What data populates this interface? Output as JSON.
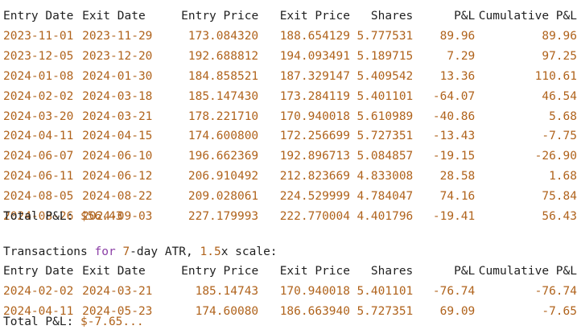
{
  "table1": {
    "headers": [
      "Entry Date",
      "Exit Date",
      "Entry Price",
      "Exit Price",
      "Shares",
      "P&L",
      "Cumulative P&L"
    ],
    "rows": [
      [
        "2023-11-01",
        "2023-11-29",
        "173.084320",
        "188.654129",
        "5.777531",
        "89.96",
        "89.96"
      ],
      [
        "2023-12-05",
        "2023-12-20",
        "192.688812",
        "194.093491",
        "5.189715",
        "7.29",
        "97.25"
      ],
      [
        "2024-01-08",
        "2024-01-30",
        "184.858521",
        "187.329147",
        "5.409542",
        "13.36",
        "110.61"
      ],
      [
        "2024-02-02",
        "2024-03-18",
        "185.147430",
        "173.284119",
        "5.401101",
        "-64.07",
        "46.54"
      ],
      [
        "2024-03-20",
        "2024-03-21",
        "178.221710",
        "170.940018",
        "5.610989",
        "-40.86",
        "5.68"
      ],
      [
        "2024-04-11",
        "2024-04-15",
        "174.600800",
        "172.256699",
        "5.727351",
        "-13.43",
        "-7.75"
      ],
      [
        "2024-06-07",
        "2024-06-10",
        "196.662369",
        "192.896713",
        "5.084857",
        "-19.15",
        "-26.90"
      ],
      [
        "2024-06-11",
        "2024-06-12",
        "206.910492",
        "212.823669",
        "4.833008",
        "28.58",
        "1.68"
      ],
      [
        "2024-08-05",
        "2024-08-22",
        "209.028061",
        "224.529999",
        "4.784047",
        "74.16",
        "75.84"
      ],
      [
        "2024-08-26",
        "2024-09-03",
        "227.179993",
        "222.770004",
        "4.401796",
        "-19.41",
        "56.43"
      ]
    ],
    "total_label": "Total P&L: ",
    "total_value": "$56.43"
  },
  "section2": {
    "prefix": "Transactions ",
    "keyword": "for",
    "space1": " ",
    "period": "7",
    "mid": "-day ATR, ",
    "scale": "1.5",
    "suffix": "x scale:"
  },
  "table2": {
    "headers": [
      "Entry Date",
      "Exit Date",
      "Entry Price",
      "Exit Price",
      "Shares",
      "P&L",
      "Cumulative P&L"
    ],
    "rows": [
      [
        "2024-02-02",
        "2024-03-21",
        "185.14743",
        "170.940018",
        "5.401101",
        "-76.74",
        "-76.74"
      ],
      [
        "2024-04-11",
        "2024-05-23",
        "174.60080",
        "186.663940",
        "5.727351",
        "69.09",
        "-7.65"
      ]
    ],
    "total_label": "Total P&L: ",
    "total_value": "$-7.65..."
  },
  "colors": {
    "number": "#b0631c",
    "keyword": "#8b3fa6",
    "text": "#1f1f1f"
  }
}
